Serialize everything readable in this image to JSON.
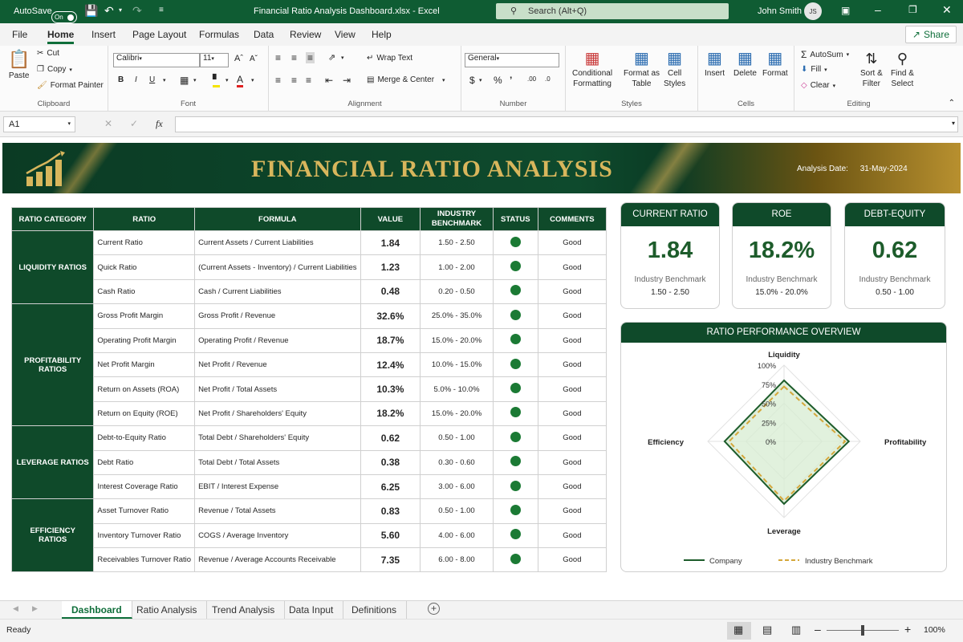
{
  "titlebar": {
    "autosave_label": "AutoSave",
    "autosave_state": "On",
    "title": "Financial Ratio Analysis Dashboard.xlsx - Excel",
    "search_placeholder": "Search (Alt+Q)",
    "user_name": "John Smith",
    "user_initials": "JS"
  },
  "menu": {
    "items": [
      "File",
      "Home",
      "Insert",
      "Page Layout",
      "Formulas",
      "Data",
      "Review",
      "View",
      "Help"
    ],
    "share": "Share"
  },
  "ribbon": {
    "clipboard": {
      "paste": "Paste",
      "cut": "Cut",
      "copy": "Copy",
      "format_painter": "Format Painter",
      "label": "Clipboard"
    },
    "font": {
      "name": "Calibri",
      "size": "11",
      "label": "Font"
    },
    "alignment": {
      "wrap": "Wrap Text",
      "merge": "Merge & Center",
      "label": "Alignment"
    },
    "number": {
      "format": "General",
      "label": "Number"
    },
    "styles": {
      "conditional": [
        "Conditional",
        "Formatting"
      ],
      "format_table": [
        "Format as",
        "Table"
      ],
      "cell_styles": [
        "Cell",
        "Styles"
      ],
      "label": "Styles"
    },
    "cells": {
      "insert": "Insert",
      "delete": "Delete",
      "format": "Format",
      "label": "Cells"
    },
    "editing": {
      "autosum": "AutoSum",
      "fill": "Fill",
      "clear": "Clear",
      "sort": [
        "Sort &",
        "Filter"
      ],
      "find": [
        "Find &",
        "Select"
      ],
      "label": "Editing"
    }
  },
  "formula_bar": {
    "name_box": "A1",
    "fx": "fx"
  },
  "dashboard": {
    "title": "FINANCIAL RATIO ANALYSIS",
    "analysis_date_label": "Analysis Date:",
    "analysis_date": "31-May-2024",
    "table_headers": [
      "RATIO CATEGORY",
      "RATIO",
      "FORMULA",
      "VALUE",
      "INDUSTRY BENCHMARK",
      "STATUS",
      "COMMENTS"
    ],
    "categories": [
      {
        "name": "LIQUIDITY RATIOS",
        "rows": [
          {
            "ratio": "Current Ratio",
            "formula": "Current Assets / Current Liabilities",
            "value": "1.84",
            "benchmark": "1.50 - 2.50",
            "comment": "Good"
          },
          {
            "ratio": "Quick Ratio",
            "formula": "(Current Assets - Inventory) / Current Liabilities",
            "value": "1.23",
            "benchmark": "1.00 - 2.00",
            "comment": "Good"
          },
          {
            "ratio": "Cash Ratio",
            "formula": "Cash / Current Liabilities",
            "value": "0.48",
            "benchmark": "0.20 - 0.50",
            "comment": "Good"
          }
        ]
      },
      {
        "name": "PROFITABILITY RATIOS",
        "rows": [
          {
            "ratio": "Gross Profit Margin",
            "formula": "Gross Profit / Revenue",
            "value": "32.6%",
            "benchmark": "25.0% - 35.0%",
            "comment": "Good"
          },
          {
            "ratio": "Operating Profit Margin",
            "formula": "Operating Profit / Revenue",
            "value": "18.7%",
            "benchmark": "15.0% - 20.0%",
            "comment": "Good"
          },
          {
            "ratio": "Net Profit Margin",
            "formula": "Net Profit / Revenue",
            "value": "12.4%",
            "benchmark": "10.0% - 15.0%",
            "comment": "Good"
          },
          {
            "ratio": "Return on Assets (ROA)",
            "formula": "Net Profit / Total Assets",
            "value": "10.3%",
            "benchmark": "5.0% - 10.0%",
            "comment": "Good"
          },
          {
            "ratio": "Return on Equity (ROE)",
            "formula": "Net Profit / Shareholders' Equity",
            "value": "18.2%",
            "benchmark": "15.0% - 20.0%",
            "comment": "Good"
          }
        ]
      },
      {
        "name": "LEVERAGE RATIOS",
        "rows": [
          {
            "ratio": "Debt-to-Equity Ratio",
            "formula": "Total Debt / Shareholders' Equity",
            "value": "0.62",
            "benchmark": "0.50 - 1.00",
            "comment": "Good"
          },
          {
            "ratio": "Debt Ratio",
            "formula": "Total Debt / Total Assets",
            "value": "0.38",
            "benchmark": "0.30 - 0.60",
            "comment": "Good"
          },
          {
            "ratio": "Interest Coverage Ratio",
            "formula": "EBIT / Interest Expense",
            "value": "6.25",
            "benchmark": "3.00 - 6.00",
            "comment": "Good"
          }
        ]
      },
      {
        "name": "EFFICIENCY RATIOS",
        "rows": [
          {
            "ratio": "Asset Turnover Ratio",
            "formula": "Revenue / Total Assets",
            "value": "0.83",
            "benchmark": "0.50 - 1.00",
            "comment": "Good"
          },
          {
            "ratio": "Inventory Turnover Ratio",
            "formula": "COGS / Average Inventory",
            "value": "5.60",
            "benchmark": "4.00 - 6.00",
            "comment": "Good"
          },
          {
            "ratio": "Receivables Turnover Ratio",
            "formula": "Revenue / Average Accounts Receivable",
            "value": "7.35",
            "benchmark": "6.00 - 8.00",
            "comment": "Good"
          }
        ]
      }
    ],
    "status_color": "#1b7a34",
    "kpis": [
      {
        "title": "CURRENT RATIO",
        "value": "1.84",
        "bench_label": "Industry Benchmark",
        "bench": "1.50 - 2.50"
      },
      {
        "title": "ROE",
        "value": "18.2%",
        "bench_label": "Industry Benchmark",
        "bench": "15.0% - 20.0%"
      },
      {
        "title": "DEBT-EQUITY",
        "value": "0.62",
        "bench_label": "Industry Benchmark",
        "bench": "0.50 - 1.00"
      }
    ]
  },
  "chart_data": {
    "type": "radar",
    "title": "RATIO PERFORMANCE OVERVIEW",
    "axes": [
      "Liquidity",
      "Profitability",
      "Leverage",
      "Efficiency"
    ],
    "ticks": [
      "0%",
      "25%",
      "50%",
      "75%",
      "100%"
    ],
    "range": [
      0,
      100
    ],
    "series": [
      {
        "name": "Company",
        "values": [
          80,
          85,
          82,
          78
        ],
        "color": "#1d5c2b",
        "dash": false
      },
      {
        "name": "Industry Benchmark",
        "values": [
          72,
          80,
          78,
          72
        ],
        "color": "#d4a73a",
        "dash": true
      }
    ],
    "legend_position": "bottom"
  },
  "sheet_tabs": [
    "Dashboard",
    "Ratio Analysis",
    "Trend Analysis",
    "Data Input",
    "Definitions"
  ],
  "status": {
    "ready": "Ready",
    "zoom": "100%"
  },
  "colors": {
    "accent": "#0f4a2a",
    "gold": "#d8b65c",
    "excel_green": "#0f5c33"
  }
}
